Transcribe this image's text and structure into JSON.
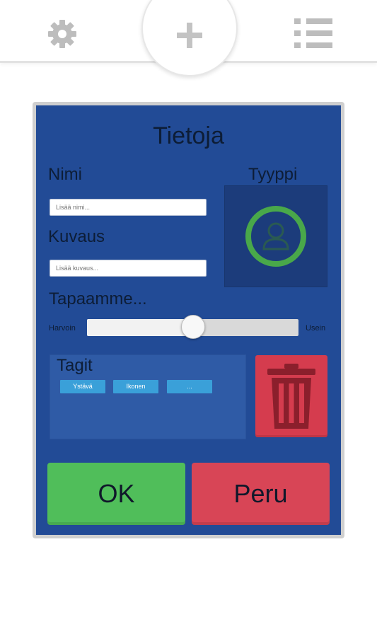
{
  "toolbar": {
    "settings_icon": "gear-icon",
    "add_icon": "plus-icon",
    "list_icon": "list-icon"
  },
  "dialog": {
    "title": "Tietoja",
    "name_label": "Nimi",
    "name_placeholder": "Lisää nimi...",
    "description_label": "Kuvaus",
    "description_placeholder": "Lisää kuvaus...",
    "type_label": "Tyyppi",
    "type_icon": "person-icon",
    "type_ring_color": "#49a84a",
    "frequency_label": "Tapaamme...",
    "slider_min_label": "Harvoin",
    "slider_max_label": "Usein",
    "slider_value": 0.5,
    "tags_label": "Tagit",
    "tags": [
      "Ystävä",
      "Ikonen",
      "..."
    ],
    "delete_icon": "trash-icon",
    "ok_label": "OK",
    "cancel_label": "Peru"
  },
  "colors": {
    "panel": "#224b96",
    "ok": "#50be5a",
    "cancel": "#d84556",
    "delete": "#d53c4e",
    "tag": "#3aa0d9"
  }
}
